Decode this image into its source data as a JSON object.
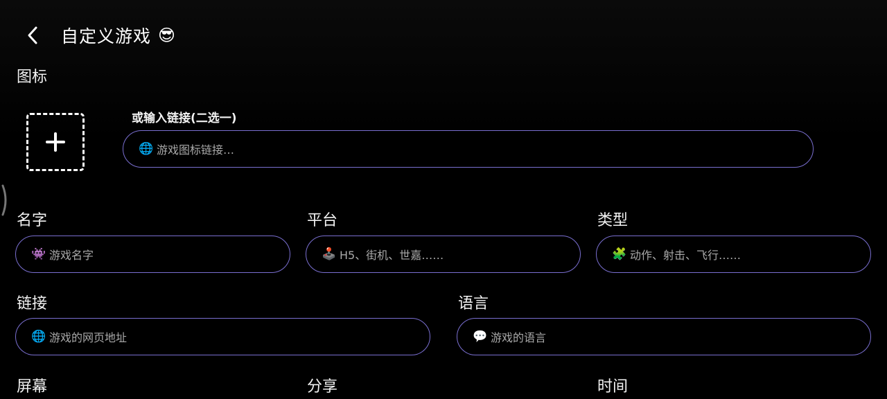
{
  "header": {
    "title": "自定义游戏",
    "emoji": "😎"
  },
  "icon_section": {
    "label": "图标",
    "alt_label": "或输入链接(二选一)",
    "link_input": {
      "icon": "🌐",
      "placeholder": "游戏图标链接…"
    }
  },
  "fields": {
    "name": {
      "label": "名字",
      "icon": "👾",
      "placeholder": "游戏名字"
    },
    "platform": {
      "label": "平台",
      "icon": "🕹️",
      "placeholder": "H5、街机、世嘉……"
    },
    "genre": {
      "label": "类型",
      "icon": "🧩",
      "placeholder": "动作、射击、飞行……"
    },
    "link": {
      "label": "链接",
      "icon": "🌐",
      "placeholder": "游戏的网页地址"
    },
    "language": {
      "label": "语言",
      "icon": "💬",
      "placeholder": "游戏的语言"
    }
  },
  "bottom_labels": {
    "screen": "屏幕",
    "share": "分享",
    "time": "时间"
  }
}
